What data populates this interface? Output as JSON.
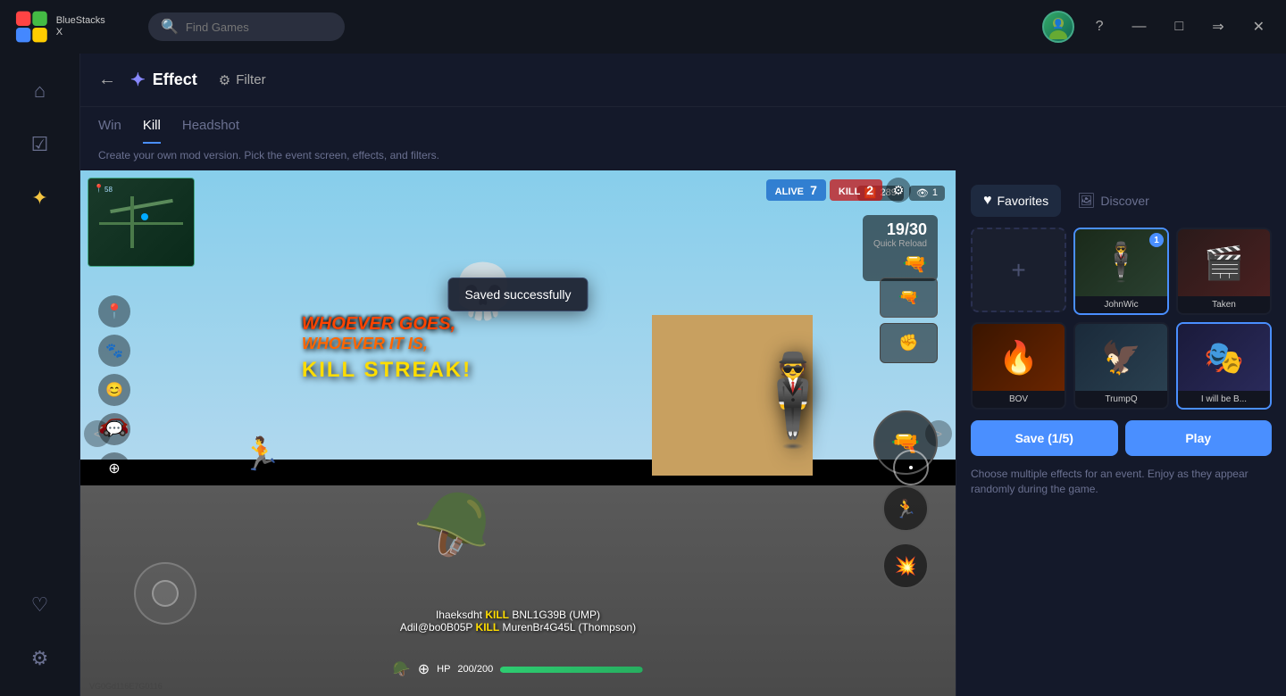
{
  "app": {
    "name": "BlueStacks X",
    "logo_emoji": "🟥🟩🟦🟨"
  },
  "titlebar": {
    "search_placeholder": "Find Games",
    "search_icon": "🔍",
    "help_icon": "?",
    "minimize_icon": "—",
    "maximize_icon": "□",
    "forward_icon": "⇒",
    "close_icon": "✕"
  },
  "sidebar": {
    "items": [
      {
        "id": "home",
        "icon": "⌂",
        "label": "Home"
      },
      {
        "id": "library",
        "icon": "☑",
        "label": "Library"
      },
      {
        "id": "effects",
        "icon": "✦",
        "label": "Effects",
        "active": true
      },
      {
        "id": "favorites",
        "icon": "♡",
        "label": "Favorites"
      },
      {
        "id": "settings",
        "icon": "⚙",
        "label": "Settings"
      }
    ]
  },
  "header": {
    "back_icon": "←",
    "title": "Effect",
    "title_icon": "✦",
    "filter_label": "Filter",
    "filter_icon": "⚙"
  },
  "tabs": {
    "items": [
      {
        "id": "win",
        "label": "Win",
        "active": false
      },
      {
        "id": "kill",
        "label": "Kill",
        "active": true
      },
      {
        "id": "headshot",
        "label": "Headshot",
        "active": false
      }
    ],
    "description": "Create your own mod version. Pick the event screen, effects, and filters."
  },
  "game": {
    "toast": "Saved successfully",
    "alive_label": "ALIVE",
    "alive_count": "7",
    "kill_label": "KILL",
    "kill_count": "2",
    "ammo_current": "19",
    "ammo_max": "30",
    "weapon_name": "Quick Reload",
    "kill_streak_text1": "WHOEVER GOES,",
    "kill_streak_text2": "WHOEVER IT IS,",
    "kill_streak_label": "KILL STREAK!",
    "signal_icon": "📶",
    "eye_icon": "👁",
    "signal_strength": "289",
    "player_count": "58",
    "kill_feed": [
      {
        "killer": "Ihaeksdht",
        "verb": "KILL",
        "victim": "BNL1G39B (UMP)"
      },
      {
        "killer": "Adil@bo0B05P",
        "verb": "KILL",
        "victim": "MurenBr4G45L (Thompson)"
      }
    ],
    "hp_current": "200",
    "hp_max": "200",
    "version": "VG0Gd116E7G0116"
  },
  "right_panel": {
    "favorites_label": "Favorites",
    "favorites_icon": "♥",
    "discover_label": "Discover",
    "discover_icon": "🖼",
    "add_icon": "+",
    "effects": [
      {
        "id": "johnwick",
        "name": "JohnWic",
        "badge": "1",
        "selected": true,
        "bg": "#1a2a1a",
        "emoji": "🕴"
      },
      {
        "id": "taken",
        "name": "Taken",
        "badge": null,
        "selected": false,
        "bg": "#2a1a1a",
        "emoji": "🎬"
      },
      {
        "id": "bov",
        "name": "BOV",
        "badge": null,
        "selected": false,
        "bg": "#3a1a00",
        "emoji": "🔥"
      },
      {
        "id": "trumpq",
        "name": "TrumpQ",
        "badge": null,
        "selected": false,
        "bg": "#1a2a3a",
        "emoji": "🦅"
      },
      {
        "id": "iwillbe",
        "name": "I will be B...",
        "badge": null,
        "selected": true,
        "bg": "#1a1a3a",
        "emoji": "🎭"
      }
    ],
    "save_label": "Save (1/5)",
    "play_label": "Play",
    "hint": "Choose multiple effects for an event. Enjoy as they appear randomly during the game."
  }
}
